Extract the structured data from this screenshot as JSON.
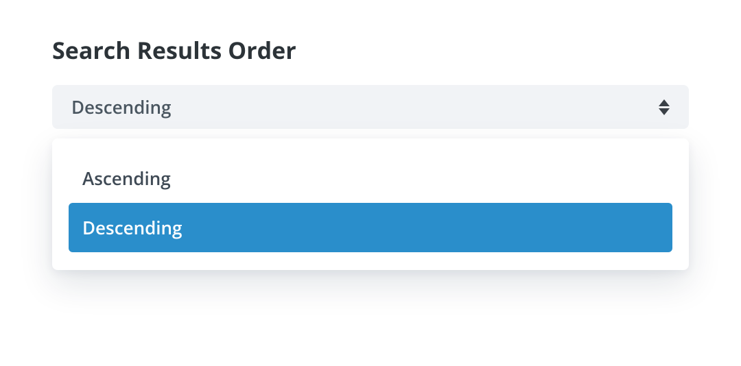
{
  "title": "Search Results Order",
  "select": {
    "value": "Descending",
    "options": [
      {
        "label": "Ascending"
      },
      {
        "label": "Descending"
      }
    ],
    "selected_index": 1
  }
}
